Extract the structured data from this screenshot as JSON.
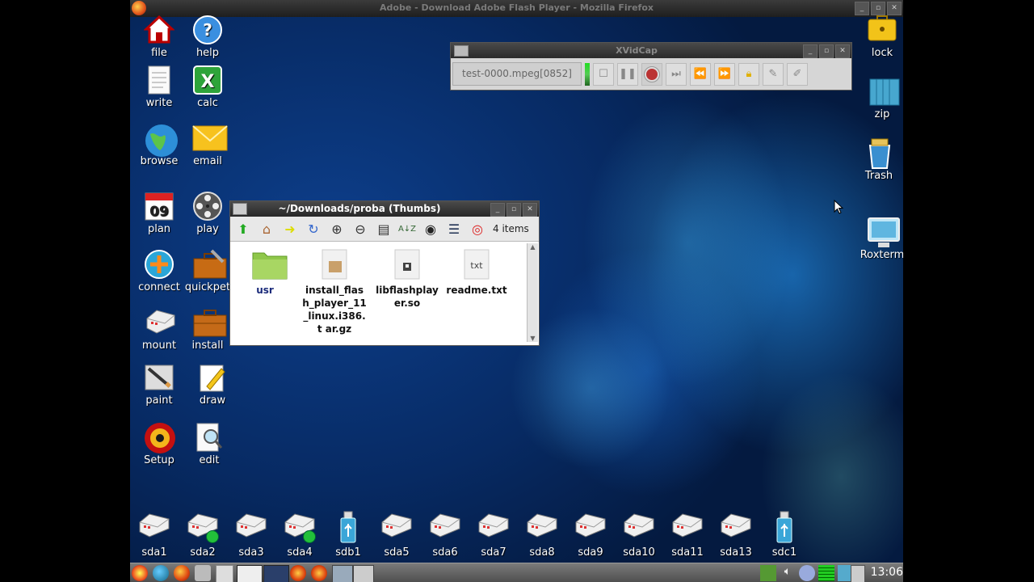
{
  "browser_title": "Adobe - Download Adobe Flash Player - Mozilla Firefox",
  "desktop_icons_left": [
    {
      "label": "file",
      "icon": "home-icon"
    },
    {
      "label": "help",
      "icon": "help-icon"
    },
    {
      "label": "write",
      "icon": "document-icon"
    },
    {
      "label": "calc",
      "icon": "spreadsheet-icon"
    },
    {
      "label": "browse",
      "icon": "globe-icon"
    },
    {
      "label": "email",
      "icon": "envelope-icon"
    },
    {
      "label": "plan",
      "icon": "calendar-icon",
      "badge": "09"
    },
    {
      "label": "play",
      "icon": "film-reel-icon"
    },
    {
      "label": "connect",
      "icon": "lifebuoy-icon"
    },
    {
      "label": "quickpet",
      "icon": "toolbox-icon"
    },
    {
      "label": "mount",
      "icon": "drive-icon"
    },
    {
      "label": "install",
      "icon": "briefcase-icon"
    },
    {
      "label": "paint",
      "icon": "paint-icon"
    },
    {
      "label": "draw",
      "icon": "pencil-icon"
    },
    {
      "label": "Setup",
      "icon": "setup-icon"
    },
    {
      "label": "edit",
      "icon": "edit-icon"
    }
  ],
  "desktop_icons_right": [
    {
      "label": "lock",
      "icon": "lock-icon"
    },
    {
      "label": "zip",
      "icon": "archive-icon"
    },
    {
      "label": "Trash",
      "icon": "trash-icon"
    },
    {
      "label": "Roxterm",
      "icon": "terminal-icon"
    }
  ],
  "xvidcap": {
    "title": "XVidCap",
    "filename": "test-0000.mpeg[0852]"
  },
  "file_manager": {
    "title": "~/Downloads/proba (Thumbs)",
    "item_count": "4 items",
    "files": [
      {
        "name": "usr",
        "type": "folder"
      },
      {
        "name": "install_flas h_player_11 _linux.i386.t ar.gz",
        "type": "archive"
      },
      {
        "name": "libflashplay er.so",
        "type": "library"
      },
      {
        "name": "readme.txt",
        "type": "text",
        "thumb_text": "txt"
      }
    ]
  },
  "drives": [
    {
      "label": "sda1",
      "mounted": false
    },
    {
      "label": "sda2",
      "mounted": true
    },
    {
      "label": "sda3",
      "mounted": false
    },
    {
      "label": "sda4",
      "mounted": true
    },
    {
      "label": "sdb1",
      "mounted": false,
      "usb": true
    },
    {
      "label": "sda5",
      "mounted": false
    },
    {
      "label": "sda6",
      "mounted": false
    },
    {
      "label": "sda7",
      "mounted": false
    },
    {
      "label": "sda8",
      "mounted": false
    },
    {
      "label": "sda9",
      "mounted": false
    },
    {
      "label": "sda10",
      "mounted": false
    },
    {
      "label": "sda11",
      "mounted": false
    },
    {
      "label": "sda13",
      "mounted": false
    },
    {
      "label": "sdc1",
      "mounted": false,
      "usb": true
    }
  ],
  "taskbar": {
    "clock": "13:06"
  },
  "colors": {
    "desktop": "#0b3a86",
    "accent": "#2aa0ff",
    "mounted_dot": "#22c03a"
  }
}
